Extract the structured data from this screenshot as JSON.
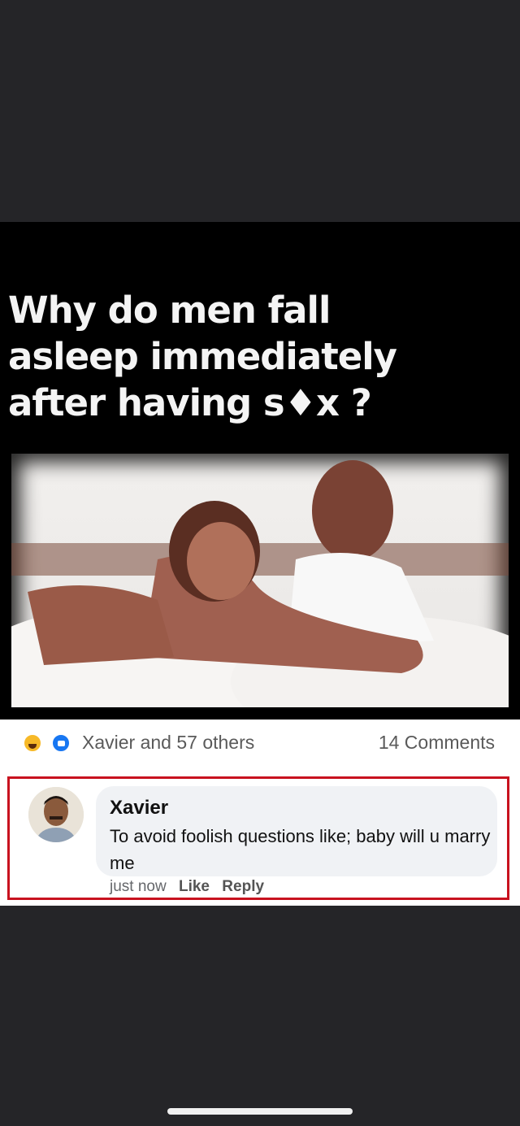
{
  "meme": {
    "title_line1": "Why do men fall",
    "title_line2": "asleep immediately",
    "title_line3": "after having s♦x ?"
  },
  "post": {
    "reactions_text": "Xavier and 57 others",
    "comments_count": "14 Comments",
    "reaction_icons": [
      "haha-icon",
      "like-icon"
    ]
  },
  "comment": {
    "author": "Xavier",
    "text": "To avoid foolish questions like; baby will u marry me",
    "timestamp": "just now",
    "like_label": "Like",
    "reply_label": "Reply"
  },
  "colors": {
    "highlight_border": "#c8121f",
    "bubble_bg": "#f0f2f5",
    "page_bg": "#252528",
    "like_blue": "#1877f2",
    "haha_yellow": "#f7b928"
  }
}
